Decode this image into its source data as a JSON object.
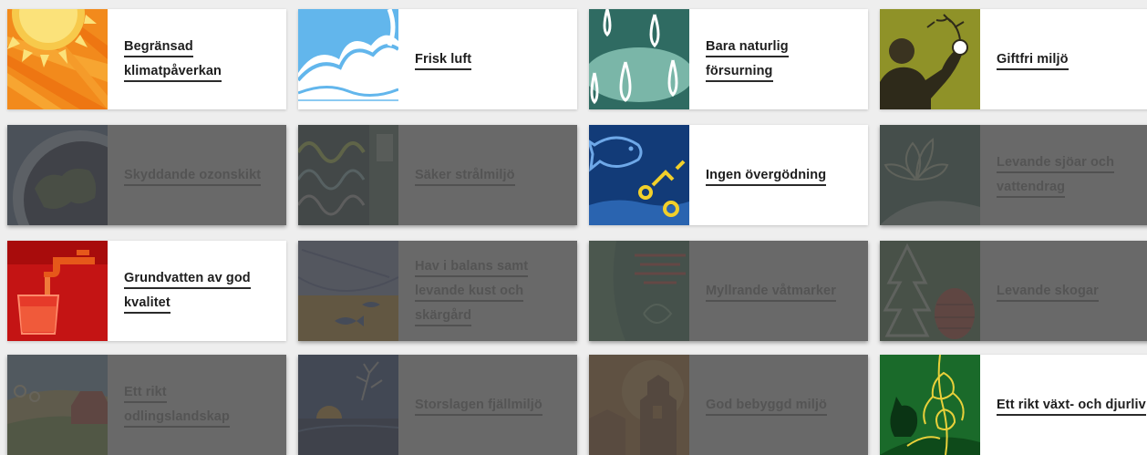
{
  "goals": [
    {
      "label": "Begränsad klimatpåverkan",
      "icon": "sun-icon",
      "dimmed": false
    },
    {
      "label": "Frisk luft",
      "icon": "clouds-icon",
      "dimmed": false
    },
    {
      "label": "Bara naturlig försurning",
      "icon": "raindrops-icon",
      "dimmed": false
    },
    {
      "label": "Giftfri miljö",
      "icon": "person-apple-icon",
      "dimmed": false
    },
    {
      "label": "Skyddande ozonskikt",
      "icon": "earth-icon",
      "dimmed": true
    },
    {
      "label": "Säker strålmiljö",
      "icon": "waves-window-icon",
      "dimmed": true
    },
    {
      "label": "Ingen övergödning",
      "icon": "fish-bubbles-icon",
      "dimmed": false
    },
    {
      "label": "Levande sjöar och vattendrag",
      "icon": "water-lily-icon",
      "dimmed": true
    },
    {
      "label": "Grundvatten av god kvalitet",
      "icon": "tap-glass-icon",
      "dimmed": false
    },
    {
      "label": "Hav i balans samt levande kust och skärgård",
      "icon": "boat-fish-icon",
      "dimmed": true
    },
    {
      "label": "Myllrande våtmarker",
      "icon": "wetland-icon",
      "dimmed": true
    },
    {
      "label": "Levande skogar",
      "icon": "forest-cone-icon",
      "dimmed": true
    },
    {
      "label": "Ett rikt odlingslandskap",
      "icon": "farmland-icon",
      "dimmed": true
    },
    {
      "label": "Storslagen fjällmiljö",
      "icon": "mountain-icon",
      "dimmed": true
    },
    {
      "label": "God bebyggd miljö",
      "icon": "town-icon",
      "dimmed": true
    },
    {
      "label": "Ett rikt växt- och djurliv",
      "icon": "orchid-lynx-icon",
      "dimmed": false
    }
  ]
}
